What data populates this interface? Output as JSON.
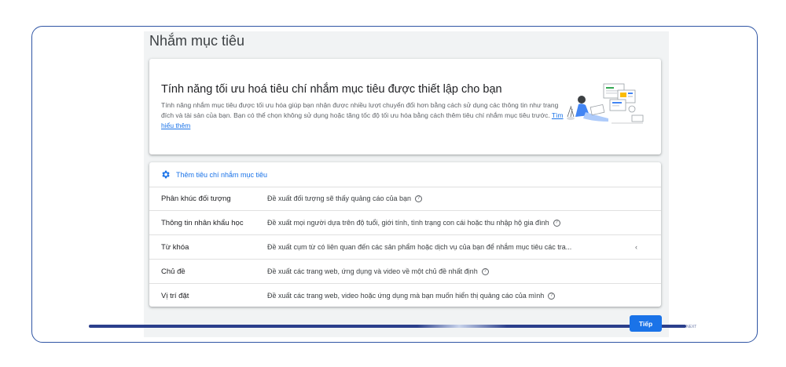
{
  "page": {
    "title": "Nhắm mục tiêu"
  },
  "banner": {
    "title": "Tính năng tối ưu hoá tiêu chí nhắm mục tiêu được thiết lập cho bạn",
    "description": "Tính năng nhắm mục tiêu được tối ưu hóa giúp bạn nhận được nhiều lượt chuyển đổi hơn bằng cách sử dụng các thông tin như trang đích và tài sản của bạn. Bạn có thể chọn không sử dụng hoặc tăng tốc độ tối ưu hóa bằng cách thêm tiêu chí nhắm mục tiêu trước.",
    "learn_more": "Tìm hiểu thêm"
  },
  "criteria": {
    "add_label": "Thêm tiêu chí nhắm mục tiêu",
    "rows": [
      {
        "name": "Phân khúc đối tượng",
        "description": "Đề xuất đối tượng sẽ thấy quảng cáo của bạn"
      },
      {
        "name": "Thông tin nhân khẩu học",
        "description": "Đề xuất mọi người dựa trên độ tuổi, giới tính, tình trạng con cái hoặc thu nhập hộ gia đình"
      },
      {
        "name": "Từ khóa",
        "description": "Đề xuất cụm từ có liên quan đến các sản phẩm hoặc dịch vụ của bạn để nhắm mục tiêu các tra..."
      },
      {
        "name": "Chủ đề",
        "description": "Đề xuất các trang web, ứng dụng và video về một chủ đề nhất định"
      },
      {
        "name": "Vị trí đặt",
        "description": "Đề xuất các trang web, video hoặc ứng dụng mà bạn muốn hiển thị quảng cáo của mình"
      }
    ]
  },
  "footer": {
    "next_label": "Tiếp",
    "progress_caption": "NEXT"
  },
  "colors": {
    "accent": "#1a73e8",
    "frame": "#2f55a4",
    "panel": "#f1f3f4"
  }
}
